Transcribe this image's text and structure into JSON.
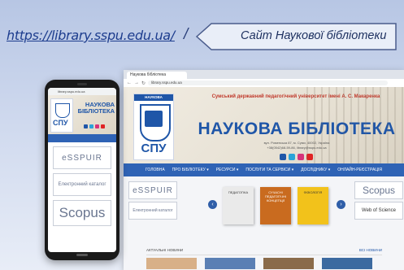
{
  "slide": {
    "url": "https://library.sspu.edu.ua/",
    "separator": "/",
    "title": "Сайт Наукової бібліотеки"
  },
  "browser": {
    "tab_title": "Наукова бібліотека",
    "address": "library.sspu.edu.ua",
    "logo_top": "НАУКОВА БІБЛІОТЕКА",
    "logo_abbr": "СПУ",
    "university": "Сумський державний педагогічний університет імені А. С. Макаренка",
    "library_title": "НАУКОВА БІБЛІОТЕКА",
    "address_line": "вул. Роменська 87, м. Суми, 40002, Україна",
    "contact_line": "+38(0542)68-59-86, library@sspu.edu.ua",
    "menu": [
      "ГОЛОВНА",
      "ПРО БІБЛІОТЕКУ ▾",
      "РЕСУРСИ ▾",
      "ПОСЛУГИ ТА СЕРВІСИ ▾",
      "ДОСЛІДНИКУ ▾",
      "ОНЛАЙН-РЕЄСТРАЦІЯ"
    ],
    "left_buttons": [
      "eSSPUIR",
      "Електронний каталог"
    ],
    "right_buttons": [
      "Scopus",
      "Web of Science"
    ],
    "book_titles": [
      "ПЕДАГОГІКА",
      "СУЧАСНІ ПЕДАГОГІЧНІ КОНЦЕПЦІЇ",
      "ФІЗІОЛОГІЯ"
    ],
    "news_label": "АКТУАЛЬНІ НОВИНИ",
    "news_more": "ВСІ НОВИНИ"
  },
  "phone": {
    "address": "library.sspu.edu.ua",
    "logo_abbr": "СПУ",
    "title": "НАУКОВА БІБЛІОТЕКА",
    "buttons": [
      "eSSPUIR",
      "Електронний каталог",
      "Scopus"
    ]
  },
  "colors": {
    "brand_blue": "#1f56a8",
    "menu_blue": "#2f63b5",
    "accent_red": "#c0392b"
  }
}
